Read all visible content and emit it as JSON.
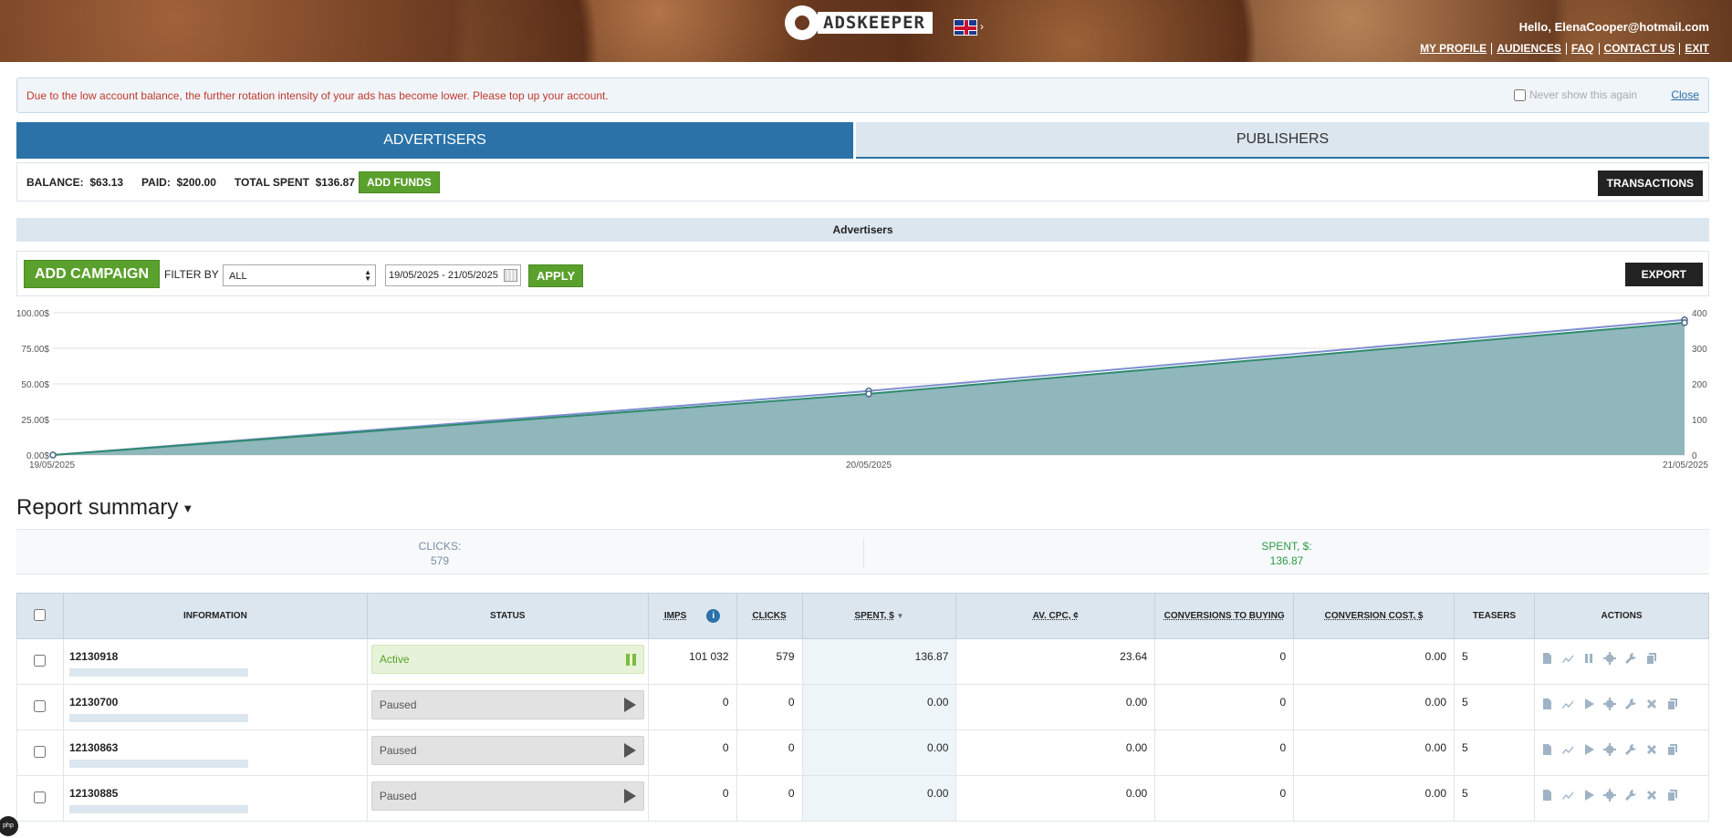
{
  "header": {
    "logo_text": "ADSKEEPER",
    "greeting": "Hello, ElenaCooper@hotmail.com",
    "nav": [
      "MY PROFILE",
      "AUDIENCES",
      "FAQ",
      "CONTACT US",
      "EXIT"
    ]
  },
  "notice": {
    "text": "Due to the low account balance, the further rotation intensity of your ads has become lower. Please top up your account.",
    "never_show": "Never show this again",
    "close": "Close"
  },
  "tabs": [
    {
      "label": "ADVERTISERS",
      "active": true
    },
    {
      "label": "PUBLISHERS",
      "active": false
    }
  ],
  "balance": {
    "balance_label": "BALANCE:",
    "balance_value": "$63.13",
    "paid_label": "PAID:",
    "paid_value": "$200.00",
    "spent_label": "TOTAL SPENT",
    "spent_value": "$136.87",
    "add_funds": "ADD FUNDS",
    "transactions": "TRANSACTIONS"
  },
  "section_title": "Advertisers",
  "filter": {
    "add_campaign": "ADD CAMPAIGN",
    "filter_by": "FILTER BY",
    "filter_value": "ALL",
    "date_range": "19/05/2025 - 21/05/2025",
    "apply": "APPLY",
    "export": "EXPORT"
  },
  "chart_data": {
    "type": "area",
    "x": [
      "19/05/2025",
      "20/05/2025",
      "21/05/2025"
    ],
    "y_left_ticks": [
      "0.00$",
      "25.00$",
      "50.00$",
      "75.00$",
      "100.00$"
    ],
    "y_right_ticks": [
      "0",
      "100",
      "200",
      "300",
      "400"
    ],
    "ylim_left": [
      0,
      100
    ],
    "ylim_right": [
      0,
      400
    ],
    "series": [
      {
        "axis": "left",
        "values": [
          0,
          45,
          95
        ],
        "color": "#7f8fd0"
      },
      {
        "axis": "left",
        "values": [
          0,
          43,
          93
        ],
        "color": "#2e8a6e",
        "fill": "#89b3b8"
      }
    ],
    "grid": true
  },
  "report": {
    "title": "Report summary",
    "clicks_label": "CLICKS:",
    "clicks_value": "579",
    "spent_label": "SPENT, $:",
    "spent_value": "136.87"
  },
  "table": {
    "headers": {
      "information": "INFORMATION",
      "status": "STATUS",
      "imps": "IMPS",
      "clicks": "CLICKS",
      "spent": "SPENT, $",
      "cpc": "AV. CPC, ¢",
      "conversions": "CONVERSIONS TO BUYING",
      "conv_cost": "CONVERSION COST, $",
      "teasers": "TEASERS",
      "actions": "ACTIONS"
    },
    "rows": [
      {
        "id": "12130918",
        "status": "Active",
        "imps": "101 032",
        "clicks": "579",
        "spent": "136.87",
        "cpc": "23.64",
        "conversions": "0",
        "conv_cost": "0.00",
        "teasers": "5"
      },
      {
        "id": "12130700",
        "status": "Paused",
        "imps": "0",
        "clicks": "0",
        "spent": "0.00",
        "cpc": "0.00",
        "conversions": "0",
        "conv_cost": "0.00",
        "teasers": "5"
      },
      {
        "id": "12130863",
        "status": "Paused",
        "imps": "0",
        "clicks": "0",
        "spent": "0.00",
        "cpc": "0.00",
        "conversions": "0",
        "conv_cost": "0.00",
        "teasers": "5"
      },
      {
        "id": "12130885",
        "status": "Paused",
        "imps": "0",
        "clicks": "0",
        "spent": "0.00",
        "cpc": "0.00",
        "conversions": "0",
        "conv_cost": "0.00",
        "teasers": "5"
      }
    ]
  },
  "php_badge": "php"
}
